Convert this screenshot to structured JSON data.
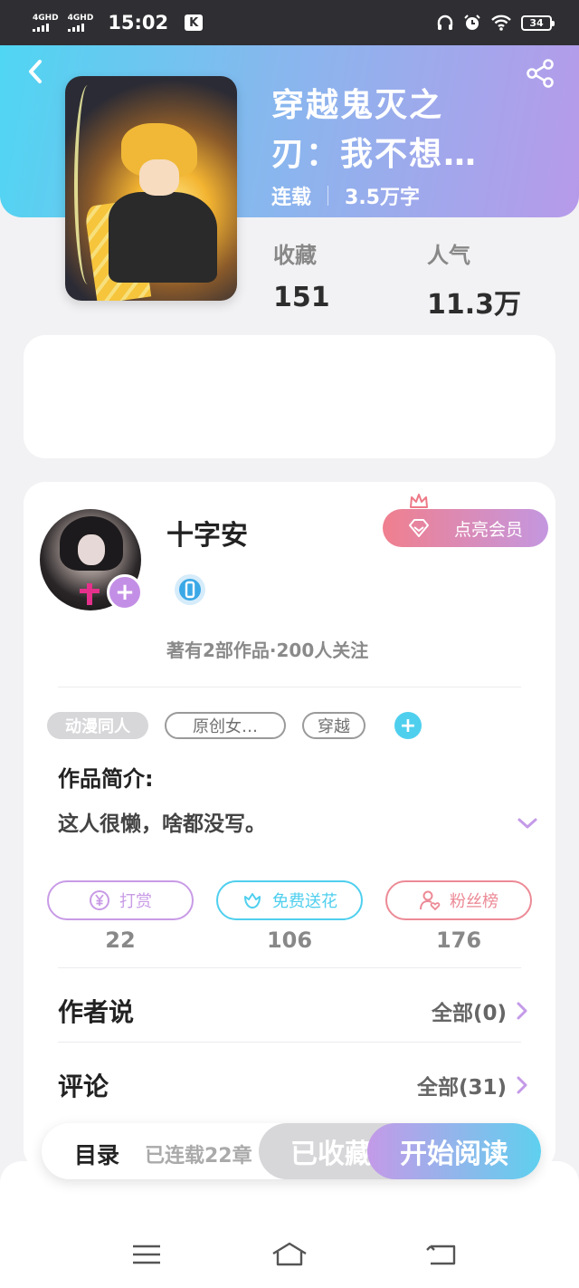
{
  "status_bar": {
    "network1": "4GHD",
    "network2": "4GHD",
    "time": "15:02",
    "app_badge": "K",
    "battery": "34"
  },
  "book": {
    "title": "穿越鬼灭之刃：我不想…",
    "status": "连载",
    "word_count": "3.5万字"
  },
  "stats": [
    {
      "label": "收藏",
      "value": "151"
    },
    {
      "label": "人气",
      "value": "11.3万"
    }
  ],
  "author": {
    "name": "十字安",
    "vip_label": "点亮会员",
    "summary": "著有2部作品·200人关注"
  },
  "tags": [
    "动漫同人",
    "原创女…",
    "穿越"
  ],
  "intro": {
    "title": "作品简介:",
    "text": "这人很懒，啥都没写。"
  },
  "actions": [
    {
      "label": "打赏",
      "count": "22",
      "color": "#c89be6"
    },
    {
      "label": "免费送花",
      "count": "106",
      "color": "#4fcfee"
    },
    {
      "label": "粉丝榜",
      "count": "176",
      "color": "#ec8a96"
    }
  ],
  "rows": {
    "author_says": {
      "title": "作者说",
      "value": "全部(0)"
    },
    "comments": {
      "title": "评论",
      "value": "全部(31)"
    }
  },
  "bottom": {
    "toc": "目录",
    "toc_sub": "已连载22章",
    "fav": "已收藏",
    "read": "开始阅读"
  },
  "colors": {
    "header_start": "#4fd6f2",
    "header_end": "#b79aea",
    "accent_purple": "#c38fe6",
    "accent_cyan": "#4fcfee"
  }
}
